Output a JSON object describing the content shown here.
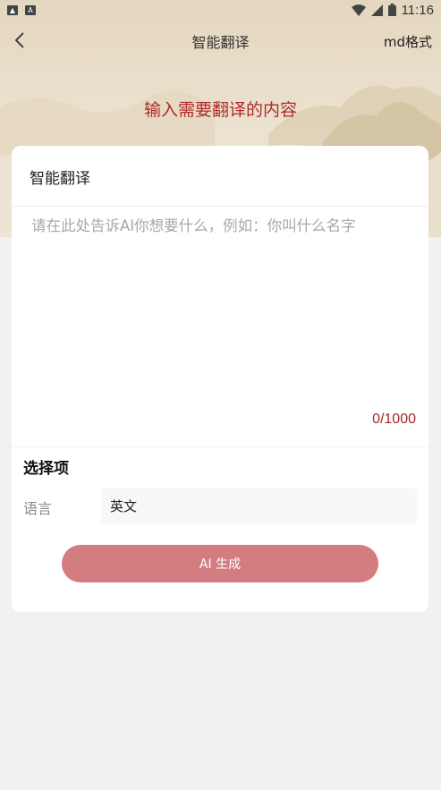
{
  "status_bar": {
    "time": "11:16",
    "left_icons": [
      "image-icon",
      "a-icon"
    ],
    "right_icons": [
      "wifi-icon",
      "signal-icon",
      "battery-icon"
    ]
  },
  "nav": {
    "title": "智能翻译",
    "right_action": "md格式"
  },
  "banner": {
    "headline": "输入需要翻译的内容"
  },
  "card": {
    "title": "智能翻译",
    "input": {
      "value": "",
      "placeholder": "请在此处告诉AI你想要什么，例如：你叫什么名字"
    },
    "counter": "0/1000"
  },
  "options": {
    "section_title": "选择项",
    "language_label": "语言",
    "language_value": "英文"
  },
  "generate_button": {
    "label": "AI 生成"
  },
  "colors": {
    "accent_red": "#b02a2a",
    "button_bg": "#d37d80",
    "page_bg": "#f1f1f1",
    "banner_bg": "#e4d7bf"
  }
}
